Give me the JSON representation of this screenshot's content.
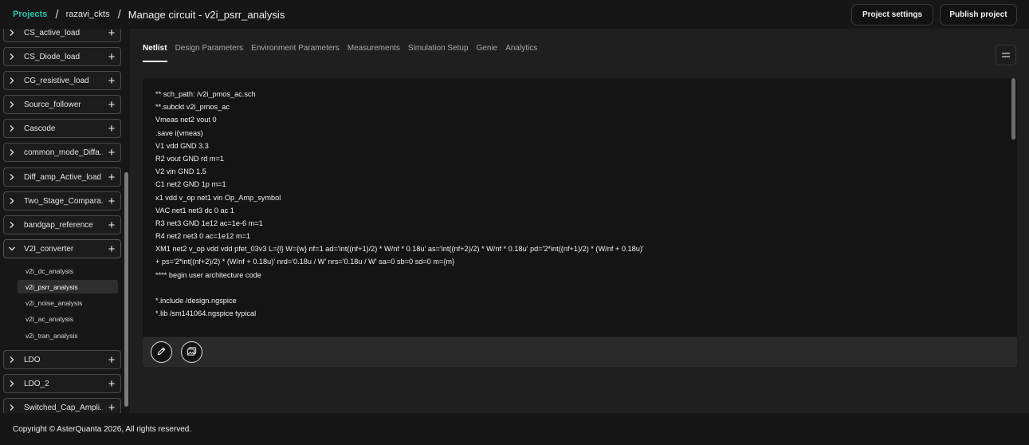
{
  "breadcrumb": {
    "projects": "Projects",
    "sep": "/",
    "project": "razavi_ckts",
    "title": "Manage circuit - v2i_psrr_analysis"
  },
  "header": {
    "settings_label": "Project settings",
    "publish_label": "Publish project"
  },
  "sidebar": {
    "items": [
      {
        "label": "CS_active_load"
      },
      {
        "label": "CS_Diode_load"
      },
      {
        "label": "CG_resistive_load"
      },
      {
        "label": "Source_follower"
      },
      {
        "label": "Cascode"
      },
      {
        "label": "common_mode_Diffa..."
      },
      {
        "label": "Diff_amp_Active_load"
      },
      {
        "label": "Two_Stage_Compara..."
      },
      {
        "label": "bandgap_reference"
      },
      {
        "label": "V2I_converter"
      },
      {
        "label": "LDO"
      },
      {
        "label": "LDO_2"
      },
      {
        "label": "Switched_Cap_Ampli..."
      }
    ],
    "subitems": [
      {
        "label": "v2i_dc_analysis"
      },
      {
        "label": "v2i_psrr_analysis"
      },
      {
        "label": "v2i_noise_analysis"
      },
      {
        "label": "v2i_ac_analysis"
      },
      {
        "label": "v2i_tran_analysis"
      }
    ]
  },
  "tabs": [
    {
      "label": "Netlist"
    },
    {
      "label": "Design Parameters"
    },
    {
      "label": "Environment Parameters"
    },
    {
      "label": "Measurements"
    },
    {
      "label": "Simulation Setup"
    },
    {
      "label": "Genie"
    },
    {
      "label": "Analytics"
    }
  ],
  "netlist": [
    "** sch_path: /v2i_pmos_ac.sch",
    "**.subckt v2i_pmos_ac",
    "Vmeas net2 vout 0",
    ".save i(vmeas)",
    "V1 vdd GND 3.3",
    "R2 vout GND rd m=1",
    "V2 vin GND 1.5",
    "C1 net2 GND 1p m=1",
    "x1 vdd v_op net1 vin Op_Amp_symbol",
    "VAC net1 net3 dc 0 ac 1",
    "R3 net3 GND 1e12 ac=1e-6 m=1",
    "R4 net2 net3 0 ac=1e12 m=1",
    "XM1 net2 v_op vdd vdd pfet_03v3 L={l} W={w} nf=1 ad='int((nf+1)/2) * W/nf * 0.18u' as='int((nf+2)/2) * W/nf * 0.18u' pd='2*int((nf+1)/2) * (W/nf + 0.18u)'",
    "+ ps='2*int((nf+2)/2) * (W/nf + 0.18u)' nrd='0.18u / W' nrs='0.18u / W' sa=0 sb=0 sd=0 m={m}",
    "**** begin user architecture code",
    "",
    "*.include /design.ngspice",
    "*.lib /sm141064.ngspice typical"
  ],
  "footer": {
    "copyright": "Copyright © AsterQuanta 2026, All rights reserved."
  },
  "colors": {
    "accent": "#23c4a8",
    "background": "#1b1b1b"
  },
  "icons": [
    "chevron-right-icon",
    "chevron-down-icon",
    "plus-icon",
    "hamburger-menu-icon",
    "pencil-icon",
    "image-icon"
  ]
}
